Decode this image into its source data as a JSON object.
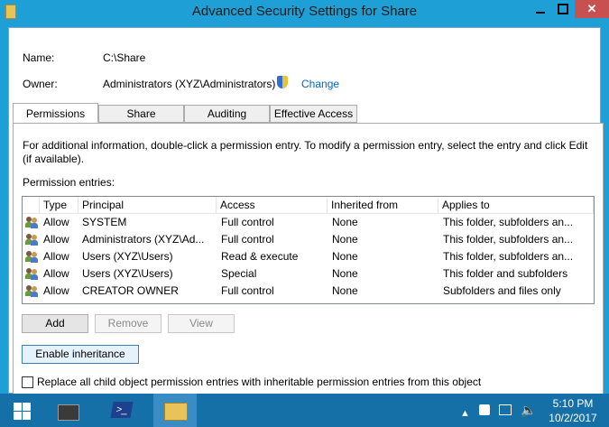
{
  "window": {
    "title": "Advanced Security Settings for Share"
  },
  "info": {
    "name_label": "Name:",
    "name_value": "C:\\Share",
    "owner_label": "Owner:",
    "owner_value": "Administrators (XYZ\\Administrators)",
    "change_link": "Change"
  },
  "tabs": [
    {
      "label": "Permissions",
      "active": true
    },
    {
      "label": "Share"
    },
    {
      "label": "Auditing"
    },
    {
      "label": "Effective Access"
    }
  ],
  "permissions": {
    "instructions_line1": "For additional information, double-click a permission entry. To modify a permission entry, select the entry and click Edit",
    "instructions_line2": "(if available).",
    "entries_label": "Permission entries:",
    "columns": [
      "Type",
      "Principal",
      "Access",
      "Inherited from",
      "Applies to"
    ],
    "rows": [
      {
        "type": "Allow",
        "principal": "SYSTEM",
        "access": "Full control",
        "inherited": "None",
        "applies": "This folder, subfolders an..."
      },
      {
        "type": "Allow",
        "principal": "Administrators (XYZ\\Ad...",
        "access": "Full control",
        "inherited": "None",
        "applies": "This folder, subfolders an..."
      },
      {
        "type": "Allow",
        "principal": "Users (XYZ\\Users)",
        "access": "Read & execute",
        "inherited": "None",
        "applies": "This folder, subfolders an..."
      },
      {
        "type": "Allow",
        "principal": "Users (XYZ\\Users)",
        "access": "Special",
        "inherited": "None",
        "applies": "This folder and subfolders"
      },
      {
        "type": "Allow",
        "principal": "CREATOR OWNER",
        "access": "Full control",
        "inherited": "None",
        "applies": "Subfolders and files only"
      }
    ],
    "add_button": "Add",
    "remove_button": "Remove",
    "view_button": "View",
    "enable_inheritance_button": "Enable inheritance",
    "replace_checkbox_label": "Replace all child object permission entries with inheritable permission entries from this object"
  },
  "taskbar": {
    "time": "5:10 PM",
    "date": "10/2/2017"
  }
}
